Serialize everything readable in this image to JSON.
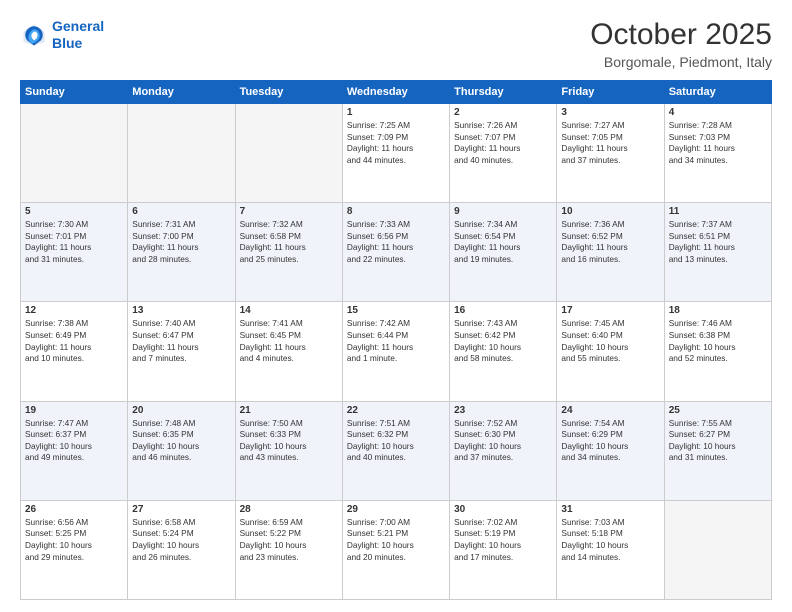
{
  "logo": {
    "line1": "General",
    "line2": "Blue"
  },
  "title": "October 2025",
  "location": "Borgomale, Piedmont, Italy",
  "days_of_week": [
    "Sunday",
    "Monday",
    "Tuesday",
    "Wednesday",
    "Thursday",
    "Friday",
    "Saturday"
  ],
  "weeks": [
    [
      {
        "day": "",
        "info": ""
      },
      {
        "day": "",
        "info": ""
      },
      {
        "day": "",
        "info": ""
      },
      {
        "day": "1",
        "info": "Sunrise: 7:25 AM\nSunset: 7:09 PM\nDaylight: 11 hours\nand 44 minutes."
      },
      {
        "day": "2",
        "info": "Sunrise: 7:26 AM\nSunset: 7:07 PM\nDaylight: 11 hours\nand 40 minutes."
      },
      {
        "day": "3",
        "info": "Sunrise: 7:27 AM\nSunset: 7:05 PM\nDaylight: 11 hours\nand 37 minutes."
      },
      {
        "day": "4",
        "info": "Sunrise: 7:28 AM\nSunset: 7:03 PM\nDaylight: 11 hours\nand 34 minutes."
      }
    ],
    [
      {
        "day": "5",
        "info": "Sunrise: 7:30 AM\nSunset: 7:01 PM\nDaylight: 11 hours\nand 31 minutes."
      },
      {
        "day": "6",
        "info": "Sunrise: 7:31 AM\nSunset: 7:00 PM\nDaylight: 11 hours\nand 28 minutes."
      },
      {
        "day": "7",
        "info": "Sunrise: 7:32 AM\nSunset: 6:58 PM\nDaylight: 11 hours\nand 25 minutes."
      },
      {
        "day": "8",
        "info": "Sunrise: 7:33 AM\nSunset: 6:56 PM\nDaylight: 11 hours\nand 22 minutes."
      },
      {
        "day": "9",
        "info": "Sunrise: 7:34 AM\nSunset: 6:54 PM\nDaylight: 11 hours\nand 19 minutes."
      },
      {
        "day": "10",
        "info": "Sunrise: 7:36 AM\nSunset: 6:52 PM\nDaylight: 11 hours\nand 16 minutes."
      },
      {
        "day": "11",
        "info": "Sunrise: 7:37 AM\nSunset: 6:51 PM\nDaylight: 11 hours\nand 13 minutes."
      }
    ],
    [
      {
        "day": "12",
        "info": "Sunrise: 7:38 AM\nSunset: 6:49 PM\nDaylight: 11 hours\nand 10 minutes."
      },
      {
        "day": "13",
        "info": "Sunrise: 7:40 AM\nSunset: 6:47 PM\nDaylight: 11 hours\nand 7 minutes."
      },
      {
        "day": "14",
        "info": "Sunrise: 7:41 AM\nSunset: 6:45 PM\nDaylight: 11 hours\nand 4 minutes."
      },
      {
        "day": "15",
        "info": "Sunrise: 7:42 AM\nSunset: 6:44 PM\nDaylight: 11 hours\nand 1 minute."
      },
      {
        "day": "16",
        "info": "Sunrise: 7:43 AM\nSunset: 6:42 PM\nDaylight: 10 hours\nand 58 minutes."
      },
      {
        "day": "17",
        "info": "Sunrise: 7:45 AM\nSunset: 6:40 PM\nDaylight: 10 hours\nand 55 minutes."
      },
      {
        "day": "18",
        "info": "Sunrise: 7:46 AM\nSunset: 6:38 PM\nDaylight: 10 hours\nand 52 minutes."
      }
    ],
    [
      {
        "day": "19",
        "info": "Sunrise: 7:47 AM\nSunset: 6:37 PM\nDaylight: 10 hours\nand 49 minutes."
      },
      {
        "day": "20",
        "info": "Sunrise: 7:48 AM\nSunset: 6:35 PM\nDaylight: 10 hours\nand 46 minutes."
      },
      {
        "day": "21",
        "info": "Sunrise: 7:50 AM\nSunset: 6:33 PM\nDaylight: 10 hours\nand 43 minutes."
      },
      {
        "day": "22",
        "info": "Sunrise: 7:51 AM\nSunset: 6:32 PM\nDaylight: 10 hours\nand 40 minutes."
      },
      {
        "day": "23",
        "info": "Sunrise: 7:52 AM\nSunset: 6:30 PM\nDaylight: 10 hours\nand 37 minutes."
      },
      {
        "day": "24",
        "info": "Sunrise: 7:54 AM\nSunset: 6:29 PM\nDaylight: 10 hours\nand 34 minutes."
      },
      {
        "day": "25",
        "info": "Sunrise: 7:55 AM\nSunset: 6:27 PM\nDaylight: 10 hours\nand 31 minutes."
      }
    ],
    [
      {
        "day": "26",
        "info": "Sunrise: 6:56 AM\nSunset: 5:25 PM\nDaylight: 10 hours\nand 29 minutes."
      },
      {
        "day": "27",
        "info": "Sunrise: 6:58 AM\nSunset: 5:24 PM\nDaylight: 10 hours\nand 26 minutes."
      },
      {
        "day": "28",
        "info": "Sunrise: 6:59 AM\nSunset: 5:22 PM\nDaylight: 10 hours\nand 23 minutes."
      },
      {
        "day": "29",
        "info": "Sunrise: 7:00 AM\nSunset: 5:21 PM\nDaylight: 10 hours\nand 20 minutes."
      },
      {
        "day": "30",
        "info": "Sunrise: 7:02 AM\nSunset: 5:19 PM\nDaylight: 10 hours\nand 17 minutes."
      },
      {
        "day": "31",
        "info": "Sunrise: 7:03 AM\nSunset: 5:18 PM\nDaylight: 10 hours\nand 14 minutes."
      },
      {
        "day": "",
        "info": ""
      }
    ]
  ]
}
